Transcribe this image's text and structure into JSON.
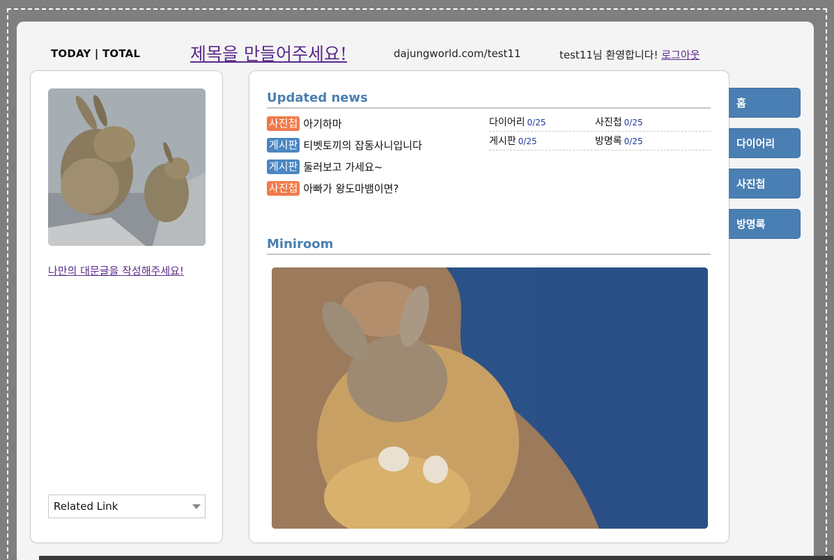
{
  "header": {
    "today_total": "TODAY | TOTAL",
    "title": "제목을 만들어주세요!",
    "url": "dajungworld.com/test11",
    "welcome_text": "test11님 환영합니다! ",
    "logout_label": "로그아웃"
  },
  "left": {
    "caption": "나만의 대문글을 작성해주세요!",
    "related_select": "Related Link"
  },
  "updated_news": {
    "title": "Updated news",
    "items": [
      {
        "category": "사진첩",
        "text": "아기하마",
        "color": "#f07a4a"
      },
      {
        "category": "게시판",
        "text": "티벳토끼의 잡동사니입니다",
        "color": "#4a86c2"
      },
      {
        "category": "게시판",
        "text": "둘러보고 가세요~",
        "color": "#4a86c2"
      },
      {
        "category": "사진첩",
        "text": "아빠가 왕도마뱀이면?",
        "color": "#f07a4a"
      }
    ],
    "stats": [
      {
        "label": "다이어리",
        "count": "0/25"
      },
      {
        "label": "사진첩",
        "count": "0/25"
      },
      {
        "label": "게시판",
        "count": "0/25"
      },
      {
        "label": "방명록",
        "count": "0/25"
      }
    ]
  },
  "miniroom": {
    "title": "Miniroom"
  },
  "nav": {
    "items": [
      "홈",
      "다이어리",
      "사진첩",
      "방명록"
    ],
    "color": "#4a7fb3"
  }
}
